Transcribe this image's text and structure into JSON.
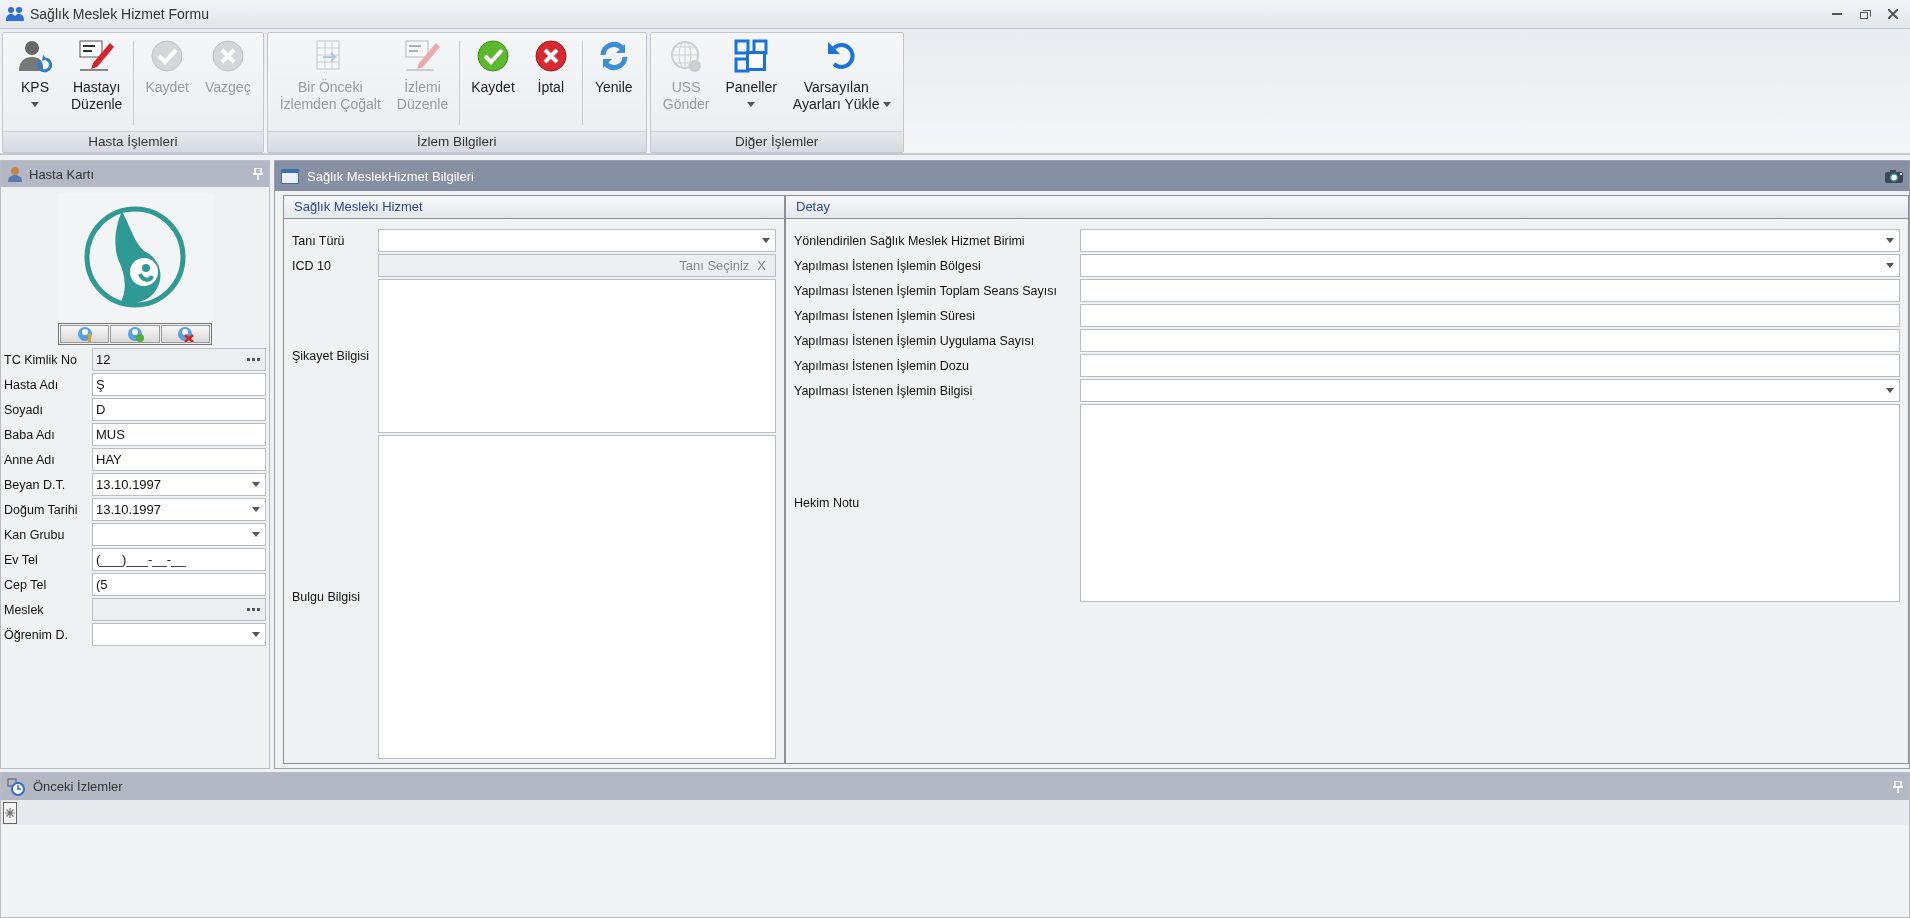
{
  "window": {
    "title": "Sağlık Meslek Hizmet Formu"
  },
  "ribbon": {
    "groups": [
      {
        "label": "Hasta İşlemleri",
        "sets": [
          [
            {
              "label": "KPS",
              "kind": "person",
              "disabled": false,
              "dropdown": true
            },
            {
              "label": "Hastayı\nDüzenle",
              "kind": "edit",
              "disabled": false,
              "dropdown": false
            }
          ],
          [
            {
              "label": "Kaydet",
              "kind": "check",
              "disabled": true,
              "dropdown": false
            },
            {
              "label": "Vazgeç",
              "kind": "cancel",
              "disabled": true,
              "dropdown": false
            }
          ]
        ]
      },
      {
        "label": "İzlem Bilgileri",
        "sets": [
          [
            {
              "label": "Bir Önceki\nİzlemden Çoğalt",
              "kind": "grid",
              "disabled": true,
              "dropdown": false
            },
            {
              "label": "İzlemi\nDüzenle",
              "kind": "edit",
              "disabled": true,
              "dropdown": false
            }
          ],
          [
            {
              "label": "Kaydet",
              "kind": "check",
              "disabled": false,
              "dropdown": false
            },
            {
              "label": "İptal",
              "kind": "cancel",
              "disabled": false,
              "dropdown": false
            }
          ],
          [
            {
              "label": "Yenile",
              "kind": "refresh",
              "disabled": false,
              "dropdown": false
            }
          ]
        ]
      },
      {
        "label": "Diğer İşlemler",
        "sets": [
          [
            {
              "label": "USS\nGönder",
              "kind": "globe",
              "disabled": true,
              "dropdown": false
            },
            {
              "label": "Paneller",
              "kind": "panels",
              "disabled": false,
              "dropdown": true
            },
            {
              "label": "Varsayılan\nAyarları Yükle",
              "kind": "undo",
              "disabled": false,
              "dropdown": true
            }
          ]
        ]
      }
    ]
  },
  "patient_card": {
    "title": "Hasta Kartı",
    "fields": [
      {
        "label": "TC Kimlik No",
        "kind": "lookup",
        "value": "12"
      },
      {
        "label": "Hasta Adı",
        "kind": "text",
        "value": "Ş"
      },
      {
        "label": "Soyadı",
        "kind": "text",
        "value": "D"
      },
      {
        "label": "Baba Adı",
        "kind": "text",
        "value": "MUS"
      },
      {
        "label": "Anne Adı",
        "kind": "text",
        "value": "HAY"
      },
      {
        "label": "Beyan D.T.",
        "kind": "combo",
        "value": "13.10.1997"
      },
      {
        "label": "Doğum Tarihi",
        "kind": "combo",
        "value": "13.10.1997"
      },
      {
        "label": "Kan Grubu",
        "kind": "combo"
      },
      {
        "label": "Ev Tel",
        "kind": "text",
        "value": "(___)___-__-__"
      },
      {
        "label": "Cep Tel",
        "kind": "text",
        "value": "(5"
      },
      {
        "label": "Meslek",
        "kind": "lookup"
      },
      {
        "label": "Öğrenim D.",
        "kind": "combo"
      }
    ]
  },
  "main_panel": {
    "title": "Sağlık MeslekHizmet Bilgileri",
    "service": {
      "title": "Sağlık Meslekı Hizmet",
      "fields": [
        {
          "label": "Tanı Türü",
          "kind": "combo"
        },
        {
          "label": "ICD 10",
          "kind": "picker",
          "placeholder": "Tanı Seçiniz",
          "clear_label": "X"
        },
        {
          "label": "Şikayet Bilgisi",
          "kind": "memo"
        },
        {
          "label": "Bulgu Bilgisi",
          "kind": "memo_fill"
        }
      ]
    },
    "detail": {
      "title": "Detay",
      "fields": [
        {
          "label": "Yönlendirilen Sağlık Meslek Hizmet Birimi",
          "kind": "combo"
        },
        {
          "label": "Yapılması İstenen İşlemin Bölgesi",
          "kind": "combo"
        },
        {
          "label": "Yapılması İstenen İşlemin Toplam Seans Sayısı",
          "kind": "text"
        },
        {
          "label": "Yapılması İstenen İşlemin Süresi",
          "kind": "text"
        },
        {
          "label": "Yapılması İstenen İşlemin Uygulama Sayısı",
          "kind": "text"
        },
        {
          "label": "Yapılması İstenen İşlemin Dozu",
          "kind": "text"
        },
        {
          "label": "Yapılması İstenen İşlemin Bilgisi",
          "kind": "combo"
        },
        {
          "label": "Hekim Notu",
          "kind": "memo"
        }
      ]
    }
  },
  "history_panel": {
    "title": "Önceki İzlemler"
  }
}
